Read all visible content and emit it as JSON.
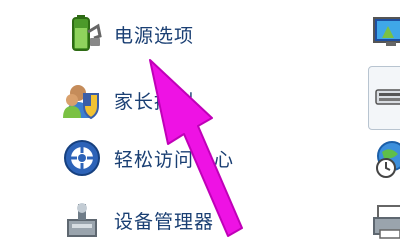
{
  "items": [
    {
      "label": "电源选项",
      "icon": "battery-power-icon"
    },
    {
      "label": "家长控制",
      "icon": "parental-controls-icon"
    },
    {
      "label": "轻松访问中心",
      "icon": "ease-of-access-icon"
    },
    {
      "label": "设备管理器",
      "icon": "device-manager-icon"
    }
  ],
  "right_icons": [
    "display-monitor-icon",
    "keyboard-icon",
    "globe-clock-icon",
    "printer-icon"
  ],
  "annotation": {
    "type": "arrow",
    "color": "#ee12e4"
  }
}
